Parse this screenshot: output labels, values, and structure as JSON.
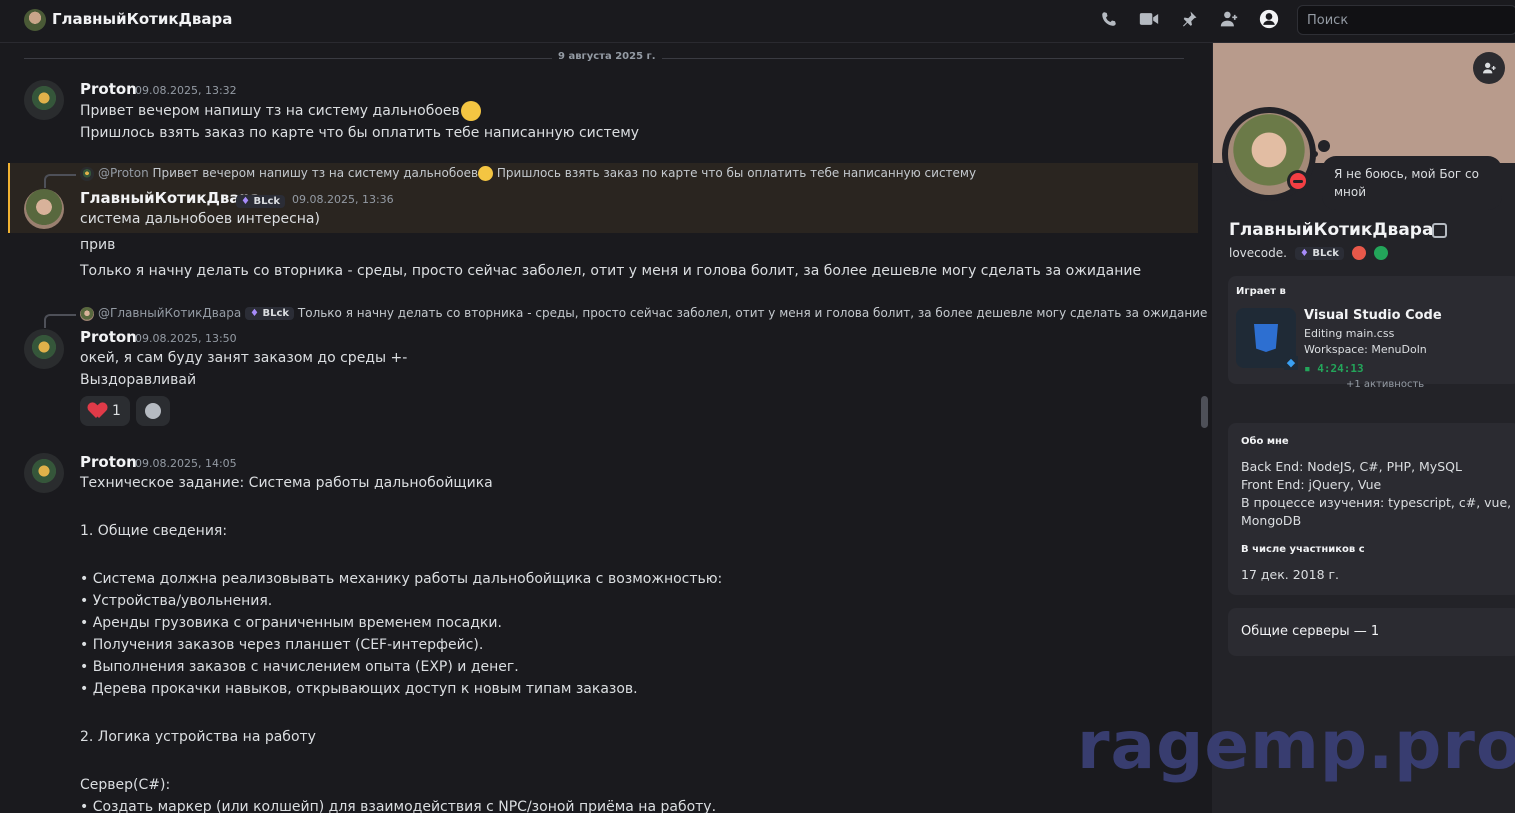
{
  "header": {
    "title": "ГлавныйКотикДвара",
    "icons": [
      "phone-icon",
      "video-icon",
      "pin-icon",
      "add-friend-icon",
      "profile-icon"
    ],
    "search_placeholder": "Поиск"
  },
  "chat": {
    "date_divider": "9 августа 2025 г.",
    "messages": [
      {
        "author": "Proton",
        "timestamp": "09.08.2025, 13:32",
        "lines": [
          "Привет вечером напишу тз на систему дальнобоев",
          "Пришлось взять заказ по карте что бы оплатить тебе написанную систему"
        ]
      },
      {
        "reply_author": "@Proton",
        "reply_text": "Привет вечером напишу тз на систему дальнобоев",
        "reply_text2": "Пришлось взять заказ по карте что бы оплатить тебе написанную систему",
        "author": "ГлавныйКотикДвара",
        "tag": "BLck",
        "timestamp": "09.08.2025, 13:36",
        "lines": [
          "система дальнобоев интересна)",
          "прив",
          "Только я начну делать со вторника - среды, просто сейчас заболел, отит у меня и голова болит, за более дешевле могу сделать за ожидание"
        ]
      },
      {
        "reply_author": "@ГлавныйКотикДвара",
        "reply_tag": "BLck",
        "reply_text": "Только я начну делать со вторника - среды, просто сейчас заболел, отит у меня и голова болит, за более дешевле могу сделать за ожидание",
        "author": "Proton",
        "timestamp": "09.08.2025, 13:50",
        "lines": [
          "окей, я сам буду занят заказом до среды +-",
          "Выздоравливай"
        ],
        "reaction_count": "1"
      },
      {
        "author": "Proton",
        "timestamp": "09.08.2025, 14:05",
        "lines": [
          "Техническое задание: Система работы дальнобойщика",
          "1. Общие сведения:",
          "• Система должна реализовывать механику работы дальнобойщика с возможностью:",
          "• Устройства/увольнения.",
          "• Аренды грузовика с ограниченным временем посадки.",
          "• Получения заказов через планшет (CEF-интерфейс).",
          "• Выполнения заказов с начислением опыта (EXP) и денег.",
          "• Дерева прокачки навыков, открывающих доступ к новым типам заказов.",
          "2. Логика устройства на работу",
          "Сервер(C#):",
          "• Создать маркер (или колшейп) для взаимодействия с NPC/зоной приёма на работу."
        ]
      }
    ]
  },
  "profile": {
    "status_bubble": "Я не боюсь, мой Бог со мной",
    "name": "ГлавныйКотикДвара",
    "username": "lovecode.",
    "tag": "BLck",
    "activity": {
      "header": "Играет в",
      "app": "Visual Studio Code",
      "detail": "Editing main.css",
      "workspace": "Workspace: MenuDoln",
      "elapsed": "4:24:13",
      "more": "+1 активность"
    },
    "about_header": "Обо мне",
    "about_lines": [
      "Back End: NodeJS, C#, PHP, MySQL",
      "Front End: jQuery, Vue",
      "В процессе изучения: typescript, c#, vue,",
      "MongoDB"
    ],
    "member_since_header": "В числе участников с",
    "member_since": "17 дек. 2018 г.",
    "mutual_servers": "Общие серверы — 1"
  },
  "watermark": "ragemp.pro",
  "colors": {
    "accent_highlight": "#f0b232",
    "online_green": "#23a55a",
    "dnd_red": "#f23f43"
  }
}
